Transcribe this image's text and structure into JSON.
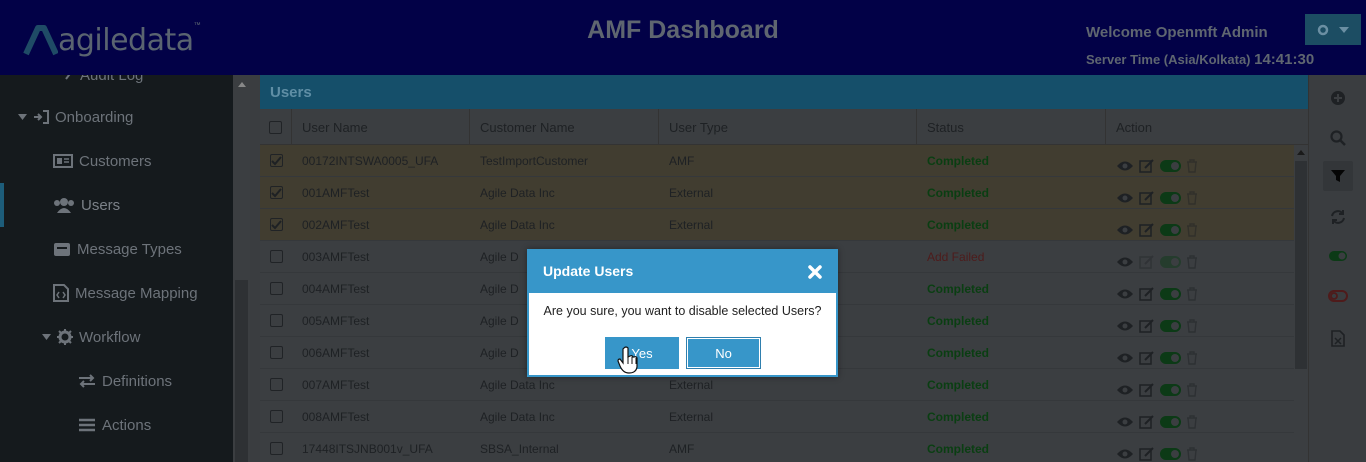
{
  "header": {
    "logo_text": "agiledata",
    "logo_tm": "™",
    "title": "AMF Dashboard",
    "welcome": "Welcome Openmft Admin",
    "server_time_label": "Server Time (Asia/Kolkata)",
    "server_time": "14:41:30"
  },
  "sidebar": {
    "items": [
      {
        "label": "Audit Log"
      },
      {
        "label": "Onboarding"
      },
      {
        "label": "Customers"
      },
      {
        "label": "Users"
      },
      {
        "label": "Message Types"
      },
      {
        "label": "Message Mapping"
      },
      {
        "label": "Workflow"
      },
      {
        "label": "Definitions"
      },
      {
        "label": "Actions"
      }
    ]
  },
  "panel": {
    "title": "Users",
    "columns": [
      "User Name",
      "Customer Name",
      "User Type",
      "Status",
      "Action"
    ]
  },
  "rows": [
    {
      "user": "00172INTSWA0005_UFA",
      "customer": "TestImportCustomer",
      "type": "AMF",
      "status": "Completed",
      "checked": true
    },
    {
      "user": "001AMFTest",
      "customer": "Agile Data Inc",
      "type": "External",
      "status": "Completed",
      "checked": true
    },
    {
      "user": "002AMFTest",
      "customer": "Agile Data Inc",
      "type": "External",
      "status": "Completed",
      "checked": true
    },
    {
      "user": "003AMFTest",
      "customer": "Agile D",
      "type": "",
      "status": "Add Failed",
      "checked": false
    },
    {
      "user": "004AMFTest",
      "customer": "Agile D",
      "type": "",
      "status": "Completed",
      "checked": false
    },
    {
      "user": "005AMFTest",
      "customer": "Agile D",
      "type": "",
      "status": "Completed",
      "checked": false
    },
    {
      "user": "006AMFTest",
      "customer": "Agile D",
      "type": "",
      "status": "Completed",
      "checked": false
    },
    {
      "user": "007AMFTest",
      "customer": "Agile Data Inc",
      "type": "External",
      "status": "Completed",
      "checked": false
    },
    {
      "user": "008AMFTest",
      "customer": "Agile Data Inc",
      "type": "External",
      "status": "Completed",
      "checked": false
    },
    {
      "user": "17448ITSJNB001v_UFA",
      "customer": "SBSA_Internal",
      "type": "AMF",
      "status": "Completed",
      "checked": false
    }
  ],
  "modal": {
    "title": "Update Users",
    "message": "Are you sure, you want to disable selected Users?",
    "yes_label": "Yes",
    "no_label": "No"
  },
  "colors": {
    "header_bg": "#020147",
    "accent": "#3796c9",
    "status_ok": "#0a3e12",
    "status_fail": "#4e1b1b"
  }
}
